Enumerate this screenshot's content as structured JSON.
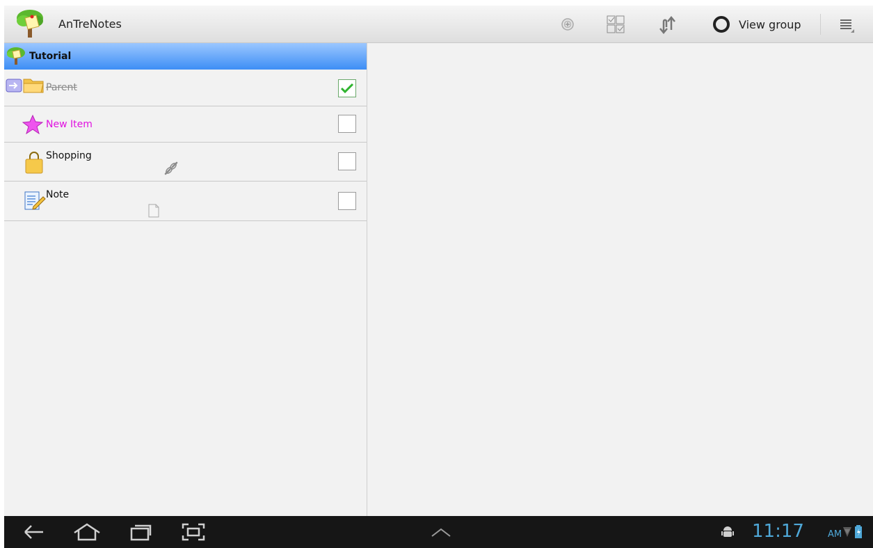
{
  "app": {
    "title": "AnTreNotes",
    "icon": "tree-note-icon"
  },
  "actionbar": {
    "buttons": [
      {
        "name": "add-circle-icon"
      },
      {
        "name": "select-checkbox-icon"
      },
      {
        "name": "move-arrows-icon"
      }
    ],
    "view_group_label": "View group",
    "view_group_icon": "circle-icon",
    "menu_icon": "overflow-menu-icon"
  },
  "tree": {
    "header": {
      "label": "Tutorial",
      "icon": "tree-icon",
      "color_top": "#9bc7ff",
      "color_bottom": "#3d8ef5"
    },
    "items": [
      {
        "label": "Parent",
        "icon": "folder-icon",
        "checked": true,
        "strikethrough": true,
        "color": "#8a8a8a"
      },
      {
        "label": "New Item",
        "icon": "star-icon",
        "checked": false,
        "color": "#e011e0"
      },
      {
        "label": "Shopping",
        "icon": "shopping-bag-icon",
        "checked": false,
        "color": "#111111",
        "sub_icon": "link-icon"
      },
      {
        "label": "Note",
        "icon": "notepad-icon",
        "checked": false,
        "color": "#111111",
        "sub_icon": "document-icon"
      }
    ]
  },
  "systembar": {
    "time": "11:17",
    "ampm": "AM",
    "accent": "#4fa8d8"
  }
}
